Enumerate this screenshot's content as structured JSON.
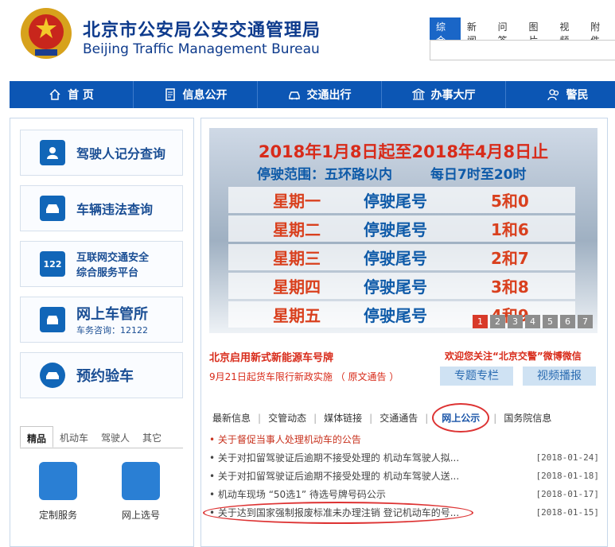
{
  "header": {
    "title_cn": "北京市公安局公安交通管理局",
    "title_en": "Beijing Traffic Management Bureau",
    "search_tabs": [
      "综合",
      "新闻",
      "问答",
      "图片",
      "视频",
      "附件"
    ],
    "search_placeholder": ""
  },
  "nav": {
    "items": [
      "首 页",
      "信息公开",
      "交通出行",
      "办事大厅",
      "警民"
    ]
  },
  "left": {
    "box1": "驾驶人记分查询",
    "box2": "车辆违法查询",
    "box3_line1": "互联网交通安全",
    "box3_line2": "综合服务平台",
    "box3_icon": "122",
    "box4_line1": "网上车管所",
    "box4_line2": "车务咨询：12122",
    "box5": "预约验车",
    "tabs": [
      "精品",
      "机动车",
      "驾驶人",
      "其它"
    ],
    "services": [
      "定制服务",
      "网上选号"
    ]
  },
  "banner": {
    "title": "2018年1月8日起至2018年4月8日止",
    "range": "停驶范围：五环路以内",
    "time": "每日7时至20时",
    "rows": [
      {
        "day": "星期一",
        "label": "停驶尾号",
        "nums": "5和0"
      },
      {
        "day": "星期二",
        "label": "停驶尾号",
        "nums": "1和6"
      },
      {
        "day": "星期三",
        "label": "停驶尾号",
        "nums": "2和7"
      },
      {
        "day": "星期四",
        "label": "停驶尾号",
        "nums": "3和8"
      },
      {
        "day": "星期五",
        "label": "停驶尾号",
        "nums": "4和9"
      }
    ],
    "pages": [
      "1",
      "2",
      "3",
      "4",
      "5",
      "6",
      "7"
    ]
  },
  "news": {
    "headline": "北京启用新式新能源车号牌",
    "sub": "9月21日起货车限行新政实施 （ 原文通告 ）",
    "welcome": "欢迎您关注“北京交警”微博微信",
    "btn_a": "专题专栏",
    "btn_b": "视频播报",
    "tabs": [
      "最新信息",
      "交管动态",
      "媒体链接",
      "交通通告",
      "网上公示",
      "国务院信息"
    ],
    "items": [
      {
        "text": "• 关于督促当事人处理机动车的公告",
        "date": ""
      },
      {
        "text": "• 关于对扣留驾驶证后逾期不接受处理的 机动车驾驶人拟...",
        "date": "[2018-01-24]"
      },
      {
        "text": "• 关于对扣留驾驶证后逾期不接受处理的 机动车驾驶人送...",
        "date": "[2018-01-18]"
      },
      {
        "text": "• 机动车现场 “50选1” 待选号牌号码公示",
        "date": "[2018-01-17]"
      },
      {
        "text": "• 关于达到国家强制报废标准未办理注销 登记机动车的号...",
        "date": "[2018-01-15]"
      }
    ]
  },
  "colors": {
    "brand": "#0c56b4",
    "accent": "#d82b1a"
  }
}
